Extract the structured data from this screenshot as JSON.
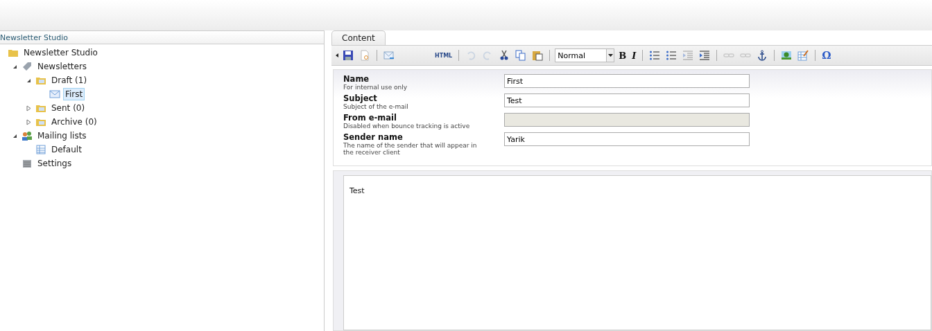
{
  "sidebar": {
    "title": "Newsletter Studio",
    "tree": [
      {
        "label": "Newsletter Studio",
        "kind": "folder",
        "selected": false,
        "children": [
          {
            "label": "Newsletters",
            "kind": "tag",
            "expanded": true,
            "selected": false,
            "children": [
              {
                "label": "Draft (1)",
                "kind": "draft",
                "expanded": true,
                "selected": false,
                "children": [
                  {
                    "label": "First",
                    "kind": "mail",
                    "selected": true
                  }
                ]
              },
              {
                "label": "Sent (0)",
                "kind": "sent",
                "expanded": false,
                "selected": false
              },
              {
                "label": "Archive (0)",
                "kind": "archive",
                "expanded": false,
                "selected": false
              }
            ]
          },
          {
            "label": "Mailing lists",
            "kind": "people",
            "expanded": true,
            "selected": false,
            "children": [
              {
                "label": "Default",
                "kind": "list",
                "selected": false
              }
            ]
          },
          {
            "label": "Settings",
            "kind": "settings",
            "selected": false
          }
        ]
      }
    ]
  },
  "tabs": [
    {
      "label": "Content",
      "selected": true
    }
  ],
  "toolbar": [
    {
      "kind": "collapse"
    },
    {
      "kind": "save",
      "disabled": false
    },
    {
      "kind": "preview",
      "disabled": false
    },
    {
      "kind": "sep"
    },
    {
      "kind": "send",
      "disabled": false
    },
    {
      "kind": "text",
      "label": "HTML",
      "disabled": false
    },
    {
      "kind": "sep"
    },
    {
      "kind": "undo",
      "disabled": true
    },
    {
      "kind": "redo",
      "disabled": true
    },
    {
      "kind": "cut",
      "disabled": false
    },
    {
      "kind": "copy",
      "disabled": false
    },
    {
      "kind": "paste",
      "disabled": false
    },
    {
      "kind": "sep"
    },
    {
      "kind": "select",
      "value": "Normal"
    },
    {
      "kind": "bold",
      "label": "B",
      "disabled": false
    },
    {
      "kind": "italic",
      "label": "I",
      "disabled": false
    },
    {
      "kind": "sep"
    },
    {
      "kind": "bullets",
      "disabled": false
    },
    {
      "kind": "numbers",
      "disabled": false
    },
    {
      "kind": "outdent",
      "disabled": true
    },
    {
      "kind": "indent",
      "disabled": false
    },
    {
      "kind": "sep"
    },
    {
      "kind": "link",
      "disabled": true
    },
    {
      "kind": "unlink",
      "disabled": true
    },
    {
      "kind": "anchor",
      "disabled": false
    },
    {
      "kind": "sep"
    },
    {
      "kind": "image",
      "disabled": false
    },
    {
      "kind": "table",
      "disabled": false
    },
    {
      "kind": "sep"
    },
    {
      "kind": "char",
      "label": "Ω",
      "disabled": false
    }
  ],
  "form": [
    {
      "label": "Name",
      "hint": "For internal use only",
      "value": "First",
      "disabled": false
    },
    {
      "label": "Subject",
      "hint": "Subject of the e-mail",
      "value": "Test",
      "disabled": false
    },
    {
      "label": "From e-mail",
      "hint": "Disabled when bounce tracking is active",
      "disabled": true
    },
    {
      "label": "Sender name",
      "hint": "The name of the sender that will appear in the receiver client",
      "value": "Yarik",
      "disabled": false
    }
  ],
  "editor": {
    "body": "Test"
  }
}
